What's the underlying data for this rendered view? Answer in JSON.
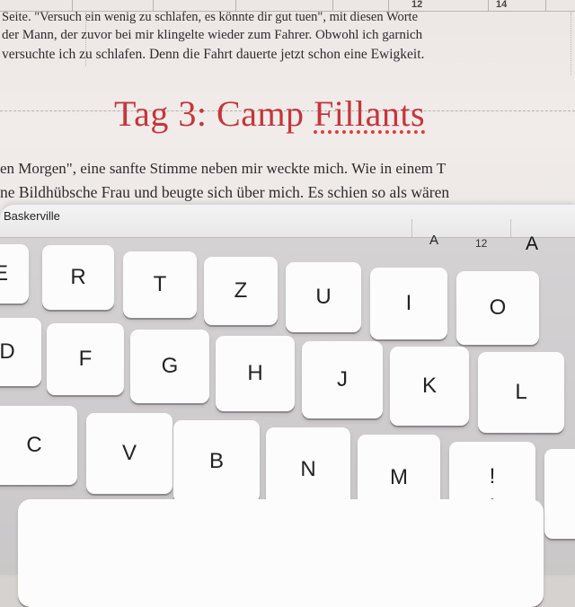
{
  "document": {
    "ruler": {
      "numbers": [
        "12",
        "14"
      ]
    },
    "lines_top": [
      "Seite. \"Versuch ein wenig zu schlafen, es könnte dir gut tuen\", mit diesen Worte",
      "der Mann, der zuvor bei mir klingelte wieder zum Fahrer. Obwohl ich garnich",
      "versuchte ich zu schlafen. Denn die Fahrt dauerte jetzt schon eine Ewigkeit."
    ],
    "heading_main": "Tag 3: Camp ",
    "heading_misspelled": "Fillants",
    "lines_bottom": [
      "en Morgen\", eine sanfte Stimme neben mir weckte mich. Wie in einem T",
      "ne Bildhübsche Frau und beugte sich über mich. Es schien so als wären"
    ]
  },
  "keyboard": {
    "font_name": "Baskerville",
    "font_size_decrease": "A",
    "font_size_value": "12",
    "font_size_increase": "A",
    "row1": [
      "E",
      "R",
      "T",
      "Z",
      "U",
      "I",
      "O"
    ],
    "row2": [
      "D",
      "F",
      "G",
      "H",
      "J",
      "K",
      "L"
    ],
    "row3": [
      "C",
      "V",
      "B",
      "N",
      "M"
    ],
    "punct_top": "!",
    "punct_bottom": ","
  }
}
